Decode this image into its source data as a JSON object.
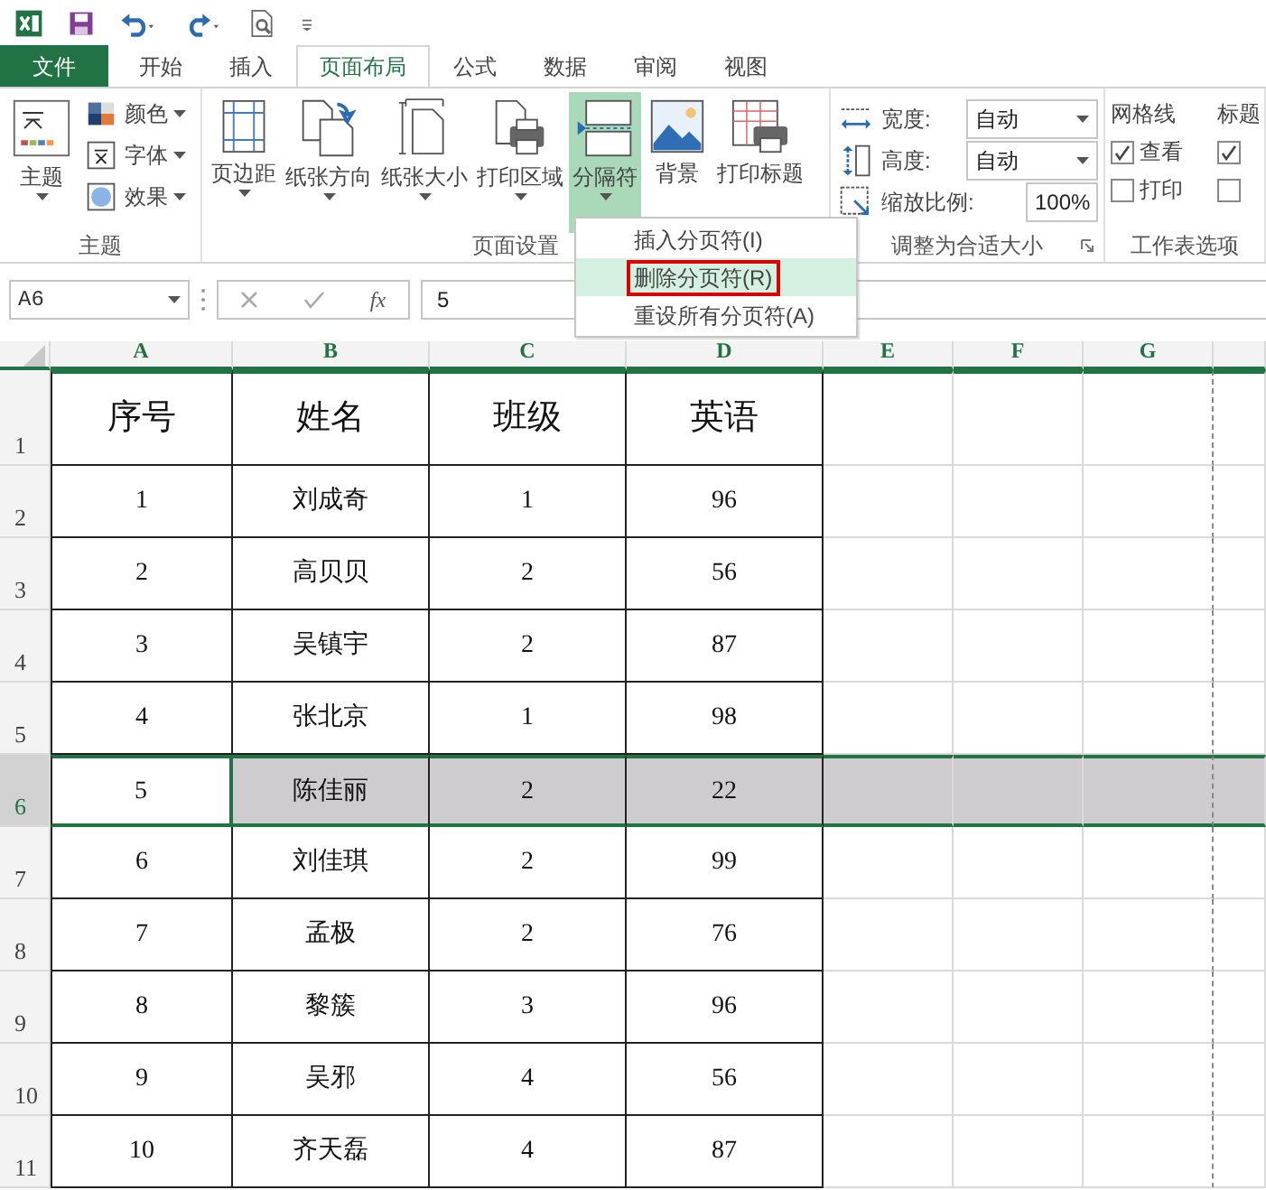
{
  "quick_access": [
    {
      "kind": "excel"
    },
    {
      "kind": "save"
    },
    {
      "kind": "undo"
    },
    {
      "kind": "redo"
    },
    {
      "kind": "preview"
    },
    {
      "kind": "customize"
    }
  ],
  "tabs": [
    {
      "label": "文件",
      "kind": "file",
      "selected": false
    },
    {
      "label": "开始",
      "kind": "tab",
      "selected": false
    },
    {
      "label": "插入",
      "kind": "tab",
      "selected": false
    },
    {
      "label": "页面布局",
      "kind": "tab",
      "selected": true
    },
    {
      "label": "公式",
      "kind": "tab",
      "selected": false
    },
    {
      "label": "数据",
      "kind": "tab",
      "selected": false
    },
    {
      "label": "审阅",
      "kind": "tab",
      "selected": false
    },
    {
      "label": "视图",
      "kind": "tab",
      "selected": false
    }
  ],
  "ribbon": {
    "groups": [
      {
        "kind": "themes",
        "label": "主题",
        "large": {
          "label": "主题"
        },
        "small": [
          {
            "label": "颜色"
          },
          {
            "label": "字体"
          },
          {
            "label": "效果"
          }
        ]
      },
      {
        "kind": "page_setup",
        "label": "页面设置",
        "buttons": [
          {
            "label": "页边距",
            "dropdown": true,
            "active": false
          },
          {
            "label": "纸张方向",
            "dropdown": true,
            "active": false
          },
          {
            "label": "纸张大小",
            "dropdown": true,
            "active": false
          },
          {
            "label": "打印区域",
            "dropdown": true,
            "active": false
          },
          {
            "label": "分隔符",
            "dropdown": true,
            "active": true
          },
          {
            "label": "背景",
            "dropdown": false,
            "active": false
          },
          {
            "label": "打印标题",
            "dropdown": false,
            "active": false
          }
        ]
      },
      {
        "kind": "scale",
        "label": "调整为合适大小",
        "rows": [
          {
            "label": "宽度:",
            "kind": "select",
            "value": "自动"
          },
          {
            "label": "高度:",
            "kind": "select",
            "value": "自动"
          },
          {
            "label": "缩放比例:",
            "kind": "spin",
            "value": "100%"
          }
        ]
      },
      {
        "kind": "sheet_options",
        "label": "工作表选项",
        "columns": [
          {
            "label": "网格线",
            "options": [
              {
                "label": "查看",
                "checked": true
              },
              {
                "label": "打印",
                "checked": false
              }
            ]
          },
          {
            "label": "标题",
            "options": [
              {
                "checked": true
              },
              {
                "checked": false
              }
            ]
          }
        ]
      }
    ]
  },
  "breaks_menu": [
    {
      "label": "插入分页符(I)",
      "hovered": false,
      "highlighted": false
    },
    {
      "label": "删除分页符(R)",
      "hovered": true,
      "highlighted": true
    },
    {
      "label": "重设所有分页符(A)",
      "hovered": false,
      "highlighted": false
    }
  ],
  "formula_bar": {
    "name_box": "A6",
    "function_label": "fx",
    "value": "5"
  },
  "sheet": {
    "columns": [
      "A",
      "B",
      "C",
      "D",
      "E",
      "F",
      "G"
    ],
    "rows": [
      {
        "number": "1",
        "kind": "header",
        "selected": false,
        "cells": [
          "序号",
          "姓名",
          "班级",
          "英语"
        ]
      },
      {
        "number": "2",
        "kind": "data",
        "selected": false,
        "cells": [
          "1",
          "刘成奇",
          "1",
          "96"
        ]
      },
      {
        "number": "3",
        "kind": "data",
        "selected": false,
        "cells": [
          "2",
          "高贝贝",
          "2",
          "56"
        ]
      },
      {
        "number": "4",
        "kind": "data",
        "selected": false,
        "cells": [
          "3",
          "吴镇宇",
          "2",
          "87"
        ]
      },
      {
        "number": "5",
        "kind": "data",
        "selected": false,
        "cells": [
          "4",
          "张北京",
          "1",
          "98"
        ]
      },
      {
        "number": "6",
        "kind": "data",
        "selected": true,
        "cells": [
          "5",
          "陈佳丽",
          "2",
          "22"
        ]
      },
      {
        "number": "7",
        "kind": "data",
        "selected": false,
        "cells": [
          "6",
          "刘佳琪",
          "2",
          "99"
        ]
      },
      {
        "number": "8",
        "kind": "data",
        "selected": false,
        "cells": [
          "7",
          "孟极",
          "2",
          "76"
        ]
      },
      {
        "number": "9",
        "kind": "data",
        "selected": false,
        "cells": [
          "8",
          "黎簇",
          "3",
          "96"
        ]
      },
      {
        "number": "10",
        "kind": "data",
        "selected": false,
        "cells": [
          "9",
          "吴邪",
          "4",
          "56"
        ]
      },
      {
        "number": "11",
        "kind": "data",
        "selected": false,
        "cells": [
          "10",
          "齐天磊",
          "4",
          "87"
        ]
      }
    ]
  }
}
